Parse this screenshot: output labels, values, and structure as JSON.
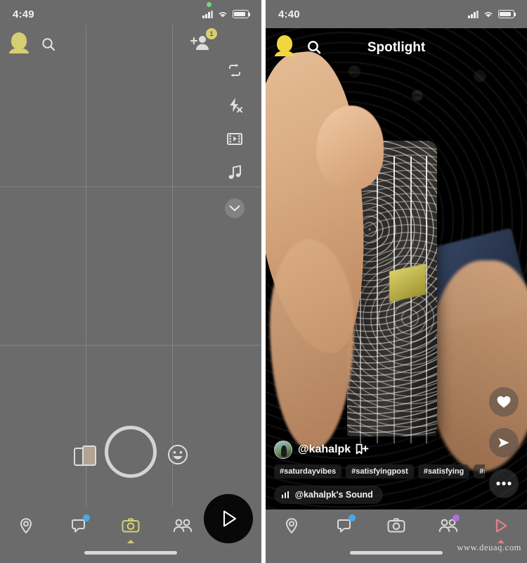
{
  "left_panel": {
    "status": {
      "time": "4:49",
      "signal_icon": "cellular-signal-icon",
      "wifi_icon": "wifi-icon",
      "battery_icon": "battery-icon"
    },
    "topbar": {
      "avatar": "profile-bitmoji-avatar",
      "search_icon": "search-icon",
      "add_friend_icon": "add-friend-icon",
      "add_friend_badge": "1",
      "flip_camera_icon": "flip-camera-icon",
      "flash_off_icon": "flash-off-icon",
      "timeline_icon": "timeline-filmstrip-icon",
      "music_icon": "music-note-icon",
      "more_icon": "chevron-down-icon"
    },
    "capture": {
      "shutter": "shutter-button",
      "lens_carousel_icon": "lens-cards-icon",
      "lens_explore_icon": "smiley-lens-icon"
    },
    "nav": [
      {
        "name": "map",
        "icon": "map-pin-icon",
        "active": false,
        "dot": ""
      },
      {
        "name": "chat",
        "icon": "chat-bubble-icon",
        "active": false,
        "dot": "#4aa8e8"
      },
      {
        "name": "camera",
        "icon": "camera-icon",
        "active": true,
        "dot": ""
      },
      {
        "name": "friends",
        "icon": "friends-icon",
        "active": false,
        "dot": ""
      },
      {
        "name": "spotlight",
        "icon": "play-triangle-icon",
        "active": false,
        "dot": ""
      }
    ],
    "spotlight_launch_icon": "play-triangle-icon",
    "active_color": "#d6cf72"
  },
  "right_panel": {
    "status": {
      "time": "4:40",
      "signal_icon": "cellular-signal-icon",
      "wifi_icon": "wifi-icon",
      "battery_icon": "battery-icon"
    },
    "header": {
      "title": "Spotlight",
      "avatar": "profile-bitmoji-avatar",
      "search_icon": "search-icon"
    },
    "actions": [
      {
        "name": "like",
        "icon": "heart-icon"
      },
      {
        "name": "share",
        "icon": "send-arrow-icon"
      },
      {
        "name": "more",
        "icon": "more-dots-icon"
      }
    ],
    "post": {
      "username": "@kahalpk",
      "subscribe_icon": "add-to-story-icon",
      "subscribe_label": "+",
      "hashtags": [
        "#saturdayvibes",
        "#satisfyingpost",
        "#satisfying",
        "#spo"
      ],
      "sound_label": "@kahalpk's Sound",
      "sound_icon": "audio-bars-icon"
    },
    "nav": [
      {
        "name": "map",
        "icon": "map-pin-icon",
        "active": false,
        "dot": ""
      },
      {
        "name": "chat",
        "icon": "chat-bubble-icon",
        "active": false,
        "dot": "#4aa8e8"
      },
      {
        "name": "camera",
        "icon": "camera-icon",
        "active": false,
        "dot": ""
      },
      {
        "name": "friends",
        "icon": "friends-icon",
        "active": false,
        "dot": "#b06de0"
      },
      {
        "name": "spotlight",
        "icon": "play-triangle-icon",
        "active": true,
        "dot": ""
      }
    ],
    "active_color": "#e0808f"
  },
  "watermark": "www.deuaq.com"
}
